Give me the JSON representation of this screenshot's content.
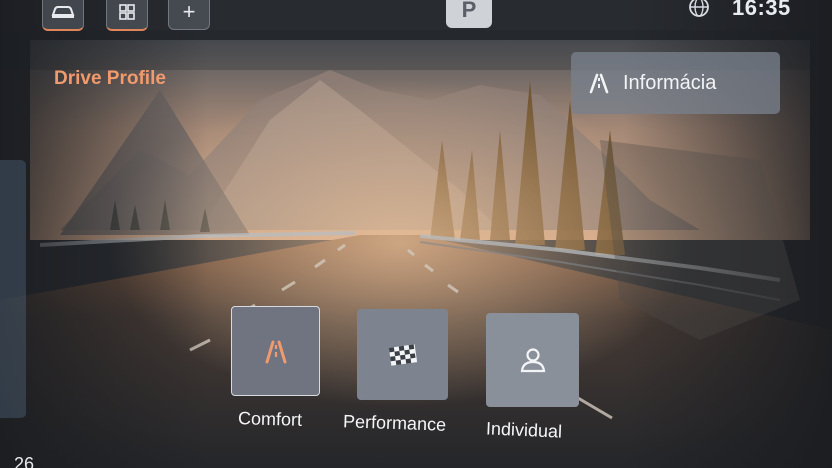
{
  "status_bar": {
    "time": "16:35",
    "gear": "P",
    "add_symbol": "+",
    "icons": [
      "car-icon",
      "apps-icon",
      "add-icon",
      "globe-icon"
    ]
  },
  "page": {
    "title": "Drive Profile",
    "info_button_label": "Informácia",
    "info_icon": "road-icon"
  },
  "profiles": [
    {
      "label": "Comfort",
      "icon": "road-icon",
      "selected": true
    },
    {
      "label": "Performance",
      "icon": "checkered-flag-icon",
      "selected": false
    },
    {
      "label": "Individual",
      "icon": "person-icon",
      "selected": false
    }
  ],
  "bottom_bar": {
    "temperature": "26"
  },
  "colors": {
    "accent": "#f09a6e",
    "tile_selected": "#6f7480",
    "tile": "#7d848f",
    "text": "#f5f6f8"
  }
}
